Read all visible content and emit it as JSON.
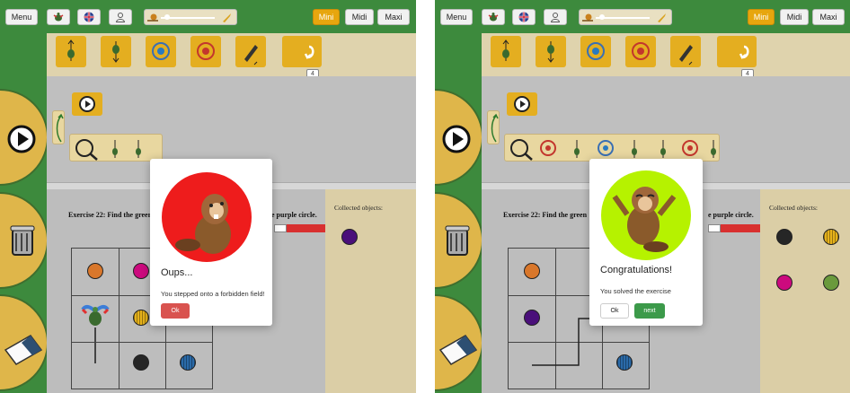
{
  "left": {
    "toolbar": {
      "menu": "Menu",
      "mini": "Mini",
      "midi": "Midi",
      "maxi": "Maxi",
      "active_size": "Mini"
    },
    "counter": "4",
    "exercise_title": "Exercise 22: Find the greer",
    "exercise_title_tail": "e purple circle.",
    "collected_title": "Collected objects:",
    "modal": {
      "title": "Oups...",
      "message": "You stepped onto a forbidden field!",
      "ok": "Ok",
      "circle_color": "#ee1c1c"
    }
  },
  "right": {
    "toolbar": {
      "menu": "Menu",
      "mini": "Mini",
      "midi": "Midi",
      "maxi": "Maxi",
      "active_size": "Mini"
    },
    "counter": "4",
    "exercise_title": "Exercise 22: Find the green",
    "exercise_title_tail": "e purple circle.",
    "collected_title": "Collected objects:",
    "modal": {
      "title": "Congratulations!",
      "message": "You solved the exercise",
      "ok": "Ok",
      "next": "next",
      "circle_color": "#b6f200"
    }
  },
  "colors": {
    "green_bar": "#3d8a3d",
    "block_orange": "#e4ae20",
    "active_btn": "#e7a60e",
    "error_btn": "#d9534f",
    "next_btn": "#3c9a4a",
    "circle_orange": "#d9772b",
    "circle_magenta": "#cc0a7e",
    "circle_purple": "#4a0f7a",
    "circle_yellow": "#e6b21b",
    "circle_black": "#262626",
    "circle_blue": "#2a6aa8",
    "circle_green": "#6a9a3c"
  }
}
